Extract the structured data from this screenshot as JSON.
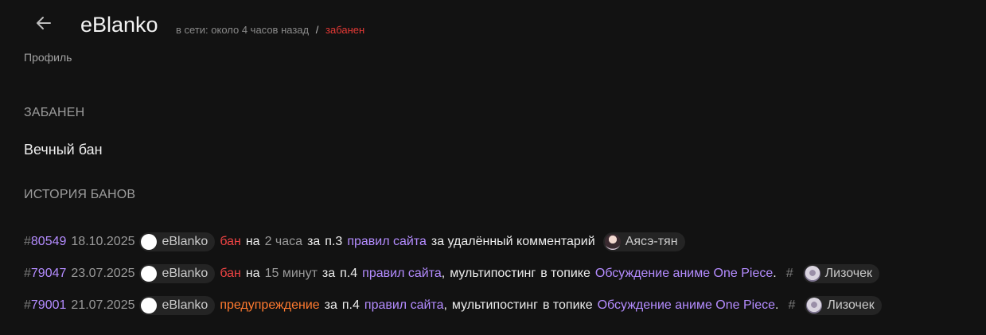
{
  "header": {
    "username": "eBlanko",
    "online_status": "в сети: около 4 часов назад",
    "separator": "/",
    "banned_status": "забанен",
    "breadcrumb": "Профиль"
  },
  "banned_section": {
    "heading": "ЗАБАНЕН",
    "value": "Вечный бан"
  },
  "history": {
    "heading": "ИСТОРИЯ БАНОВ",
    "hash": "#",
    "rows": [
      {
        "id": "80549",
        "date": "18.10.2025",
        "user": "eBlanko",
        "action": "бан",
        "na": "на",
        "duration": "2 часа",
        "za": "за",
        "rule": "п.3",
        "rules_link": "правил сайта",
        "reason": "за удалённый комментарий",
        "moderator": "Аясэ-тян"
      },
      {
        "id": "79047",
        "date": "23.07.2025",
        "user": "eBlanko",
        "action": "бан",
        "na": "на",
        "duration": "15 минут",
        "za": "за",
        "rule": "п.4",
        "rules_link": "правил сайта",
        "comma": ",",
        "reason": "мультипостинг",
        "in_topic": "в топике",
        "topic": "Обсуждение аниме One Piece",
        "dot": ".",
        "hash": "#",
        "moderator": "Лизочек"
      },
      {
        "id": "79001",
        "date": "21.07.2025",
        "user": "eBlanko",
        "action": "предупреждение",
        "za": "за",
        "rule": "п.4",
        "rules_link": "правил сайта",
        "comma": ",",
        "reason": "мультипостинг",
        "in_topic": "в топике",
        "topic": "Обсуждение аниме One Piece",
        "dot": ".",
        "hash": "#",
        "moderator": "Лизочек"
      }
    ]
  },
  "colors": {
    "background": "#121212",
    "accent_link": "#b48cff",
    "ban_red": "#ef4444",
    "warning_orange": "#ff7a2f"
  },
  "icons": {
    "back": "arrow-left-icon"
  }
}
